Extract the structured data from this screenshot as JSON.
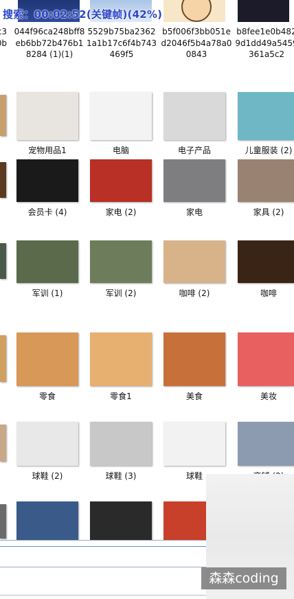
{
  "overlay": {
    "search_text": "搜索：00:02:52(关键帧)(42%)"
  },
  "watermark": {
    "text": "森森coding"
  },
  "top_row": [
    {
      "name": "c3\n0b"
    },
    {
      "name": "044f96ca248bff8eb6bb72b476b18284 (1)(1)"
    },
    {
      "name": "5529b75ba23621a1b17c6f4b743469f5"
    },
    {
      "name": "b5f006f3bb051ed2046f5b4a78a00843"
    },
    {
      "name": "b8fee1e0b4829d1dd49a5459361a5c2"
    }
  ],
  "rows": [
    [
      "宠物用品1",
      "电脑",
      "电子产品",
      "儿童服装 (2)"
    ],
    [
      "会员卡 (4)",
      "家电 (2)",
      "家电",
      "家具 (2)"
    ],
    [
      "军训 (1)",
      "军训 (2)",
      "咖啡 (2)",
      "咖啡"
    ],
    [
      "零食",
      "零食1",
      "美食",
      "美妆"
    ],
    [
      "球鞋 (2)",
      "球鞋 (3)",
      "球鞋",
      "商铺 (2)"
    ],
    [
      "",
      "",
      "",
      ""
    ]
  ],
  "thumb_colors": [
    [
      "#e8e4df",
      "#f3f3f3",
      "#d9d9d9",
      "#6fb7c4"
    ],
    [
      "#1a1a1a",
      "#b83026",
      "#7e7e80",
      "#9a8272"
    ],
    [
      "#5a6a4a",
      "#6d7d5c",
      "#d8b38a",
      "#3a2416"
    ],
    [
      "#d89858",
      "#e8b070",
      "#c8703a",
      "#e86060"
    ],
    [
      "#e8e8e8",
      "#c8c8c8",
      "#f2f2f2",
      "#8c9bb0"
    ],
    [
      "#3a5a8a",
      "#2a2a2a",
      "#c8402a",
      "#cccccc"
    ]
  ],
  "left_edge_colors": [
    "#c8a070",
    "#5a3a20",
    "#4a5a4a",
    "#d0a060",
    "#c8a888",
    "#6a6a6a"
  ]
}
